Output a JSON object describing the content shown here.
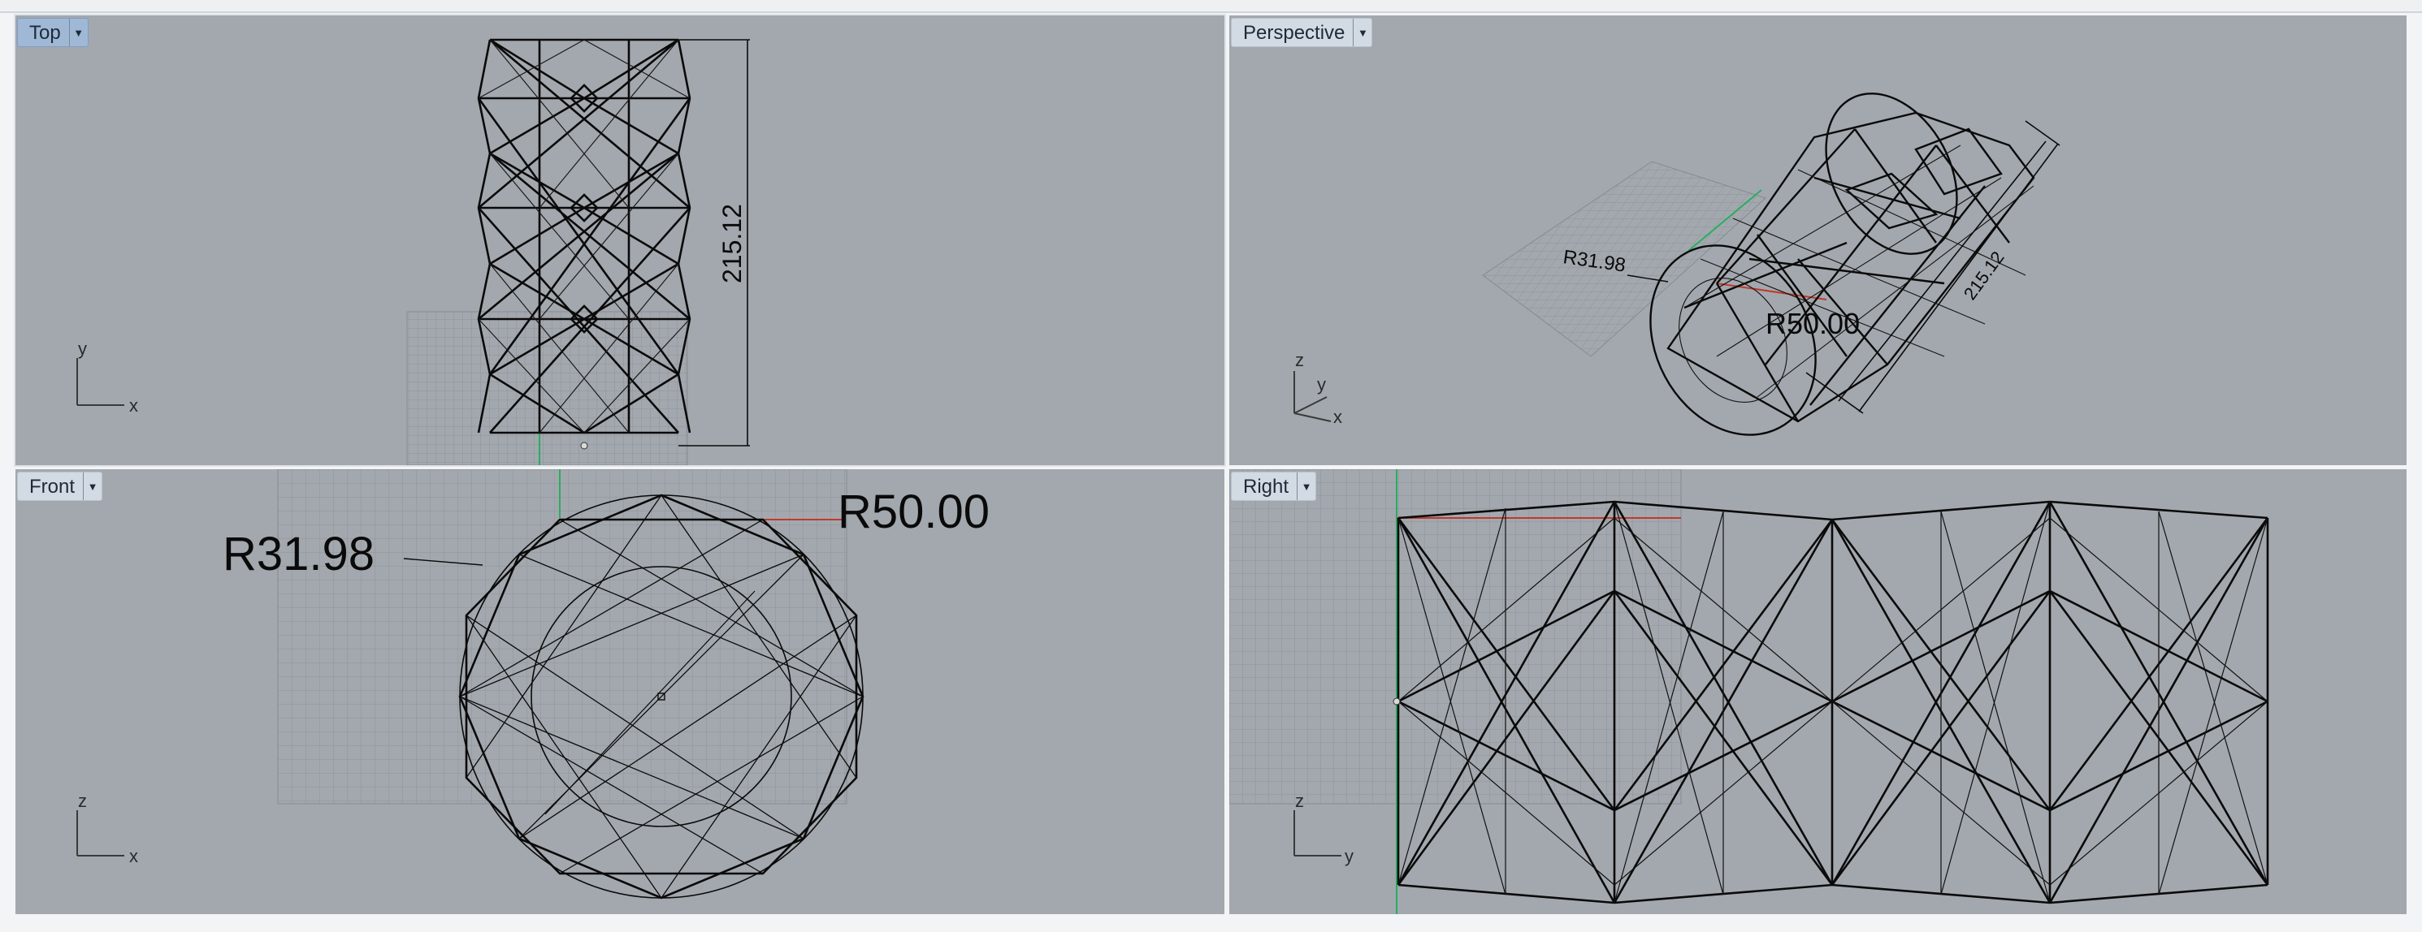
{
  "viewports": [
    {
      "id": "top",
      "label": "Top",
      "active": true,
      "axes": [
        "y",
        "x"
      ]
    },
    {
      "id": "perspective",
      "label": "Perspective",
      "active": false,
      "axes": [
        "z",
        "y",
        "x"
      ]
    },
    {
      "id": "front",
      "label": "Front",
      "active": false,
      "axes": [
        "z",
        "x"
      ]
    },
    {
      "id": "right",
      "label": "Right",
      "active": false,
      "axes": [
        "z",
        "y"
      ]
    }
  ],
  "dimensions": {
    "top_length": "215.12",
    "perspective_length": "215.12",
    "perspective_radius": "R31.98",
    "perspective_radius_outer": "R50.00",
    "front_outer_radius": "R50.00",
    "front_inner_radius": "R31.98"
  },
  "colors": {
    "viewport_bg": "#a3a8ae",
    "grid": "#8f959c",
    "wire": "#0a0a0a",
    "x_axis": "#c0392b",
    "y_axis": "#27ae60",
    "active_tab": "#9fb8d6"
  }
}
